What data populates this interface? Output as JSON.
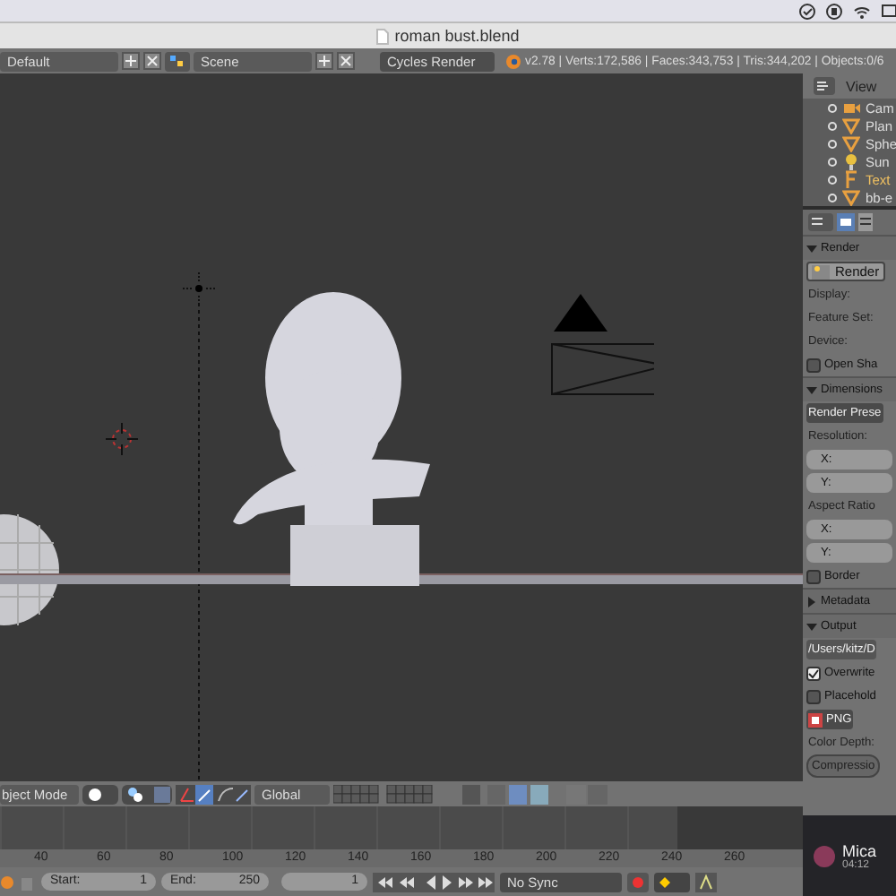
{
  "window": {
    "title": "roman bust.blend"
  },
  "info_header": {
    "layout": "Default",
    "scene": "Scene",
    "engine": "Cycles Render",
    "stats": "v2.78 | Verts:172,586 | Faces:343,753 | Tris:344,202 | Objects:0/6"
  },
  "outliner": {
    "view_menu": "View",
    "items": [
      {
        "label": "Cam",
        "kind": "camera"
      },
      {
        "label": "Plan",
        "kind": "mesh"
      },
      {
        "label": "Sphe",
        "kind": "mesh"
      },
      {
        "label": "Sun",
        "kind": "lamp"
      },
      {
        "label": "Text",
        "kind": "text"
      },
      {
        "label": "bb-e",
        "kind": "mesh"
      }
    ]
  },
  "properties": {
    "rows": [
      {
        "kind": "header",
        "label": "Render",
        "expanded": true
      },
      {
        "kind": "button",
        "label": "Render"
      },
      {
        "kind": "label",
        "label": "Display:"
      },
      {
        "kind": "label",
        "label": "Feature Set:"
      },
      {
        "kind": "label",
        "label": "Device:"
      },
      {
        "kind": "checkbox",
        "label": "Open Sha",
        "checked": false
      },
      {
        "kind": "header",
        "label": "Dimensions",
        "expanded": true
      },
      {
        "kind": "menu",
        "label": "Render Prese"
      },
      {
        "kind": "label",
        "label": "Resolution:"
      },
      {
        "kind": "field",
        "label": "X:"
      },
      {
        "kind": "field",
        "label": "Y:"
      },
      {
        "kind": "label",
        "label": "Aspect Ratio"
      },
      {
        "kind": "field",
        "label": "X:"
      },
      {
        "kind": "field",
        "label": "Y:"
      },
      {
        "kind": "checkbox",
        "label": "Border",
        "checked": false
      },
      {
        "kind": "header",
        "label": "Metadata",
        "expanded": false
      },
      {
        "kind": "header",
        "label": "Output",
        "expanded": true
      },
      {
        "kind": "path",
        "label": "/Users/kitz/D"
      },
      {
        "kind": "checkbox",
        "label": "Overwrite",
        "checked": true
      },
      {
        "kind": "checkbox",
        "label": "Placehold",
        "checked": false
      },
      {
        "kind": "menu",
        "label": "PNG"
      },
      {
        "kind": "label",
        "label": "Color Depth:"
      },
      {
        "kind": "pill",
        "label": "Compressio"
      }
    ]
  },
  "notification": {
    "title": "Mica",
    "time": "04:12"
  },
  "viewport_header": {
    "mode": "bject Mode",
    "orientation": "Global"
  },
  "timeline": {
    "ticks": [
      "40",
      "60",
      "80",
      "100",
      "120",
      "140",
      "160",
      "180",
      "200",
      "220",
      "240",
      "260"
    ],
    "start_label": "Start:",
    "start": "1",
    "end_label": "End:",
    "end": "250",
    "frame": "1",
    "sync": "No Sync"
  }
}
